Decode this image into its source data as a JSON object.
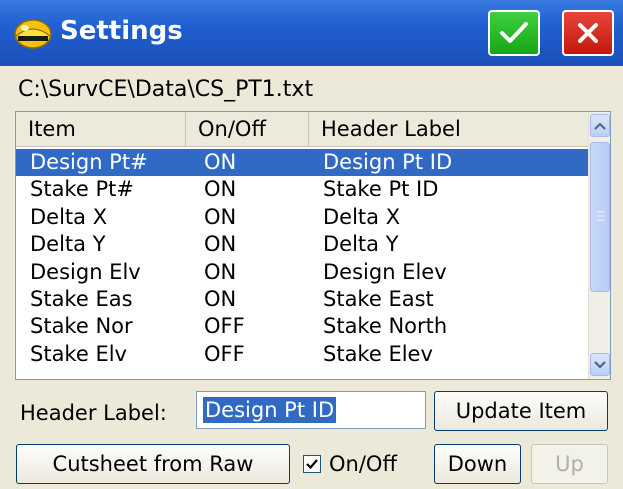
{
  "window": {
    "title": "Settings",
    "ok_icon": "checkmark-icon",
    "close_icon": "close-icon",
    "ok_color": "#2fbf2f",
    "close_color": "#d9261c"
  },
  "file_path": "C:\\SurvCE\\Data\\CS_PT1.txt",
  "table": {
    "columns": [
      "Item",
      "On/Off",
      "Header Label"
    ],
    "selected_index": 0,
    "rows": [
      {
        "item": "Design Pt#",
        "state": "ON",
        "label": "Design Pt ID"
      },
      {
        "item": "Stake Pt#",
        "state": "ON",
        "label": "Stake Pt ID"
      },
      {
        "item": "Delta X",
        "state": "ON",
        "label": "Delta X"
      },
      {
        "item": "Delta Y",
        "state": "ON",
        "label": "Delta Y"
      },
      {
        "item": "Design Elv",
        "state": "ON",
        "label": "Design Elev"
      },
      {
        "item": "Stake Eas",
        "state": "ON",
        "label": "Stake East"
      },
      {
        "item": "Stake Nor",
        "state": "OFF",
        "label": "Stake North"
      },
      {
        "item": "Stake Elv",
        "state": "OFF",
        "label": "Stake Elev"
      }
    ]
  },
  "header_label": {
    "label": "Header Label:",
    "value": "Design Pt ID"
  },
  "buttons": {
    "update_item": "Update Item",
    "cutsheet_from_raw": "Cutsheet from Raw",
    "on_off": "On/Off",
    "on_off_checked": true,
    "down": "Down",
    "up": "Up",
    "up_enabled": false
  },
  "colors": {
    "titlebar": "#1f5fd0",
    "selection": "#316ac5",
    "background": "#ece9d8"
  }
}
